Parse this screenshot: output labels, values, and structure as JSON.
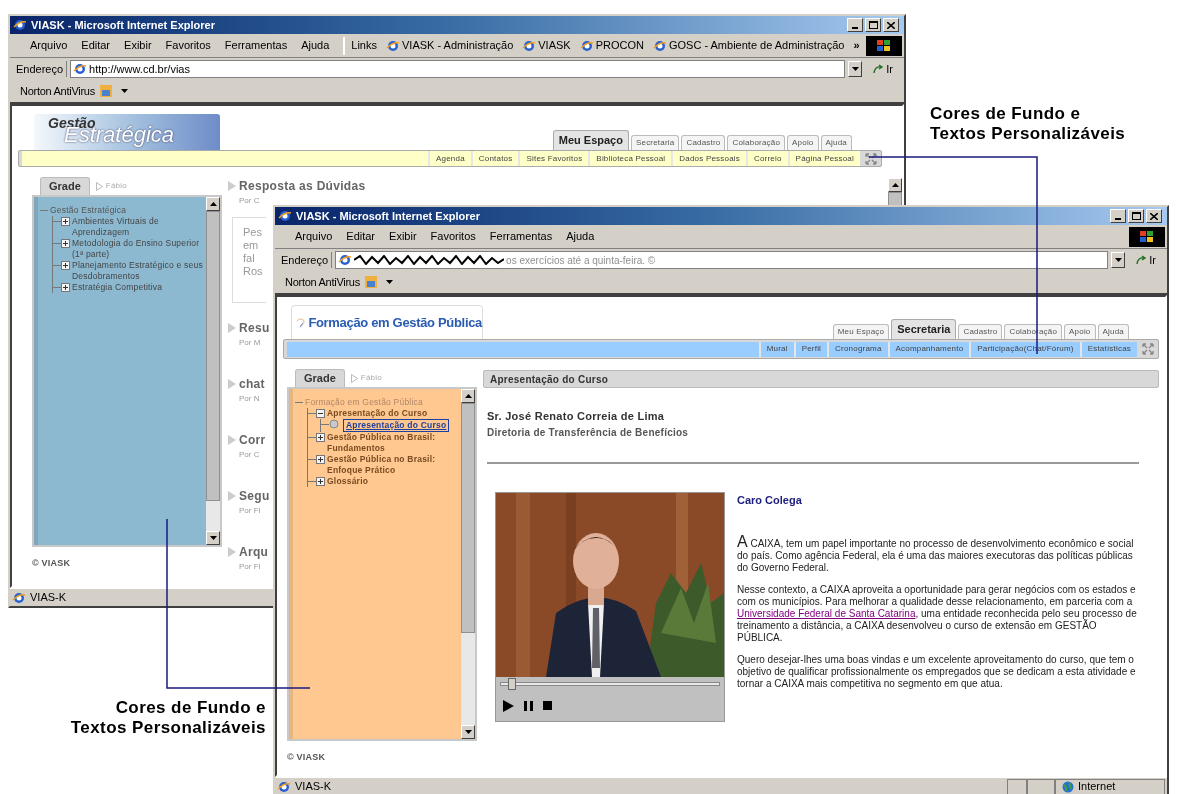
{
  "back_window": {
    "title": "VIASK - Microsoft Internet Explorer",
    "menu": [
      "Arquivo",
      "Editar",
      "Exibir",
      "Favoritos",
      "Ferramentas",
      "Ajuda"
    ],
    "links_label": "Links",
    "links": [
      "VIASK - Administração",
      "VIASK",
      "PROCON",
      "GOSC - Ambiente de Administração"
    ],
    "links_more": "»",
    "address_label": "Endereço",
    "address": "http://www.cd.br/vias",
    "go": "Ir",
    "toolbar": "Norton AntiVirus",
    "logo": [
      "Gestão",
      "Estratégica"
    ],
    "tabs": [
      {
        "label": "Meu Espaço",
        "selected": true
      },
      {
        "label": "Secretaria",
        "selected": false
      },
      {
        "label": "Cadastro",
        "selected": false
      },
      {
        "label": "Colaboração",
        "selected": false
      },
      {
        "label": "Apoio",
        "selected": false
      },
      {
        "label": "Ajuda",
        "selected": false
      }
    ],
    "subnav": [
      "Agenda",
      "Contatos",
      "Sites Favoritos",
      "Biblioteca Pessoal",
      "Dados Pessoais",
      "Correio",
      "Página Pessoal"
    ],
    "grade_tab": "Grade",
    "breadcrumb": "Fábio",
    "tree": [
      {
        "label": "Gestão Estratégica",
        "selected": false,
        "children": [
          {
            "label": "Ambientes Virtuais de Aprendizagem",
            "expanded": false,
            "selected": false
          },
          {
            "label": "Metodologia do Ensino Superior (1ª parte)",
            "expanded": false,
            "selected": false
          },
          {
            "label": "Planejamento Estratégico e seus Desdobramentos",
            "expanded": false,
            "selected": false
          },
          {
            "label": "Estratégia Competitiva",
            "expanded": false,
            "selected": false
          }
        ]
      }
    ],
    "copyright": "© VIASK",
    "posts": [
      {
        "title": "Resposta as Dúvidas",
        "by": "Por C",
        "excerpt": [
          "Pes",
          "em",
          "fal",
          "Ros"
        ]
      },
      {
        "title": "Resu",
        "by": "Por M"
      },
      {
        "title": "chat",
        "by": "Por N"
      },
      {
        "title": "Corr",
        "by": "Por C"
      },
      {
        "title": "Segu",
        "by": "Por Fl"
      },
      {
        "title": "Arqu",
        "by": "Por Fl"
      }
    ],
    "status": "VIAS-K"
  },
  "front_window": {
    "title": "VIASK - Microsoft Internet Explorer",
    "menu": [
      "Arquivo",
      "Editar",
      "Exibir",
      "Favoritos",
      "Ferramentas",
      "Ajuda"
    ],
    "address_label": "Endereço",
    "address": "os exercícios até a quinta-feira. ©",
    "go": "Ir",
    "toolbar": "Norton AntiVirus",
    "logo": "Formação em Gestão Pública",
    "tabs": [
      {
        "label": "Meu Espaço",
        "selected": false
      },
      {
        "label": "Secretaria",
        "selected": true
      },
      {
        "label": "Cadastro",
        "selected": false
      },
      {
        "label": "Colaboração",
        "selected": false
      },
      {
        "label": "Apoio",
        "selected": false
      },
      {
        "label": "Ajuda",
        "selected": false
      }
    ],
    "subnav": [
      "Mural",
      "Perfil",
      "Cronograma",
      "Acompanhamento",
      "Participação(Chat/Fórum)",
      "Estatísticas"
    ],
    "grade_tab": "Grade",
    "breadcrumb": "Fábio",
    "tree": [
      {
        "label": "Formação em Gestão Pública",
        "selected": false,
        "children": [
          {
            "label": "Apresentação do Curso",
            "expanded": true,
            "selected": false,
            "children": [
              {
                "label": "Apresentação do Curso",
                "selected": true
              }
            ]
          },
          {
            "label": "Gestão Pública no Brasil: Fundamentos",
            "expanded": false,
            "selected": false
          },
          {
            "label": "Gestão Pública no Brasil: Enfoque Prático",
            "expanded": false,
            "selected": false
          },
          {
            "label": "Glossário",
            "expanded": false,
            "selected": false
          }
        ]
      }
    ],
    "copyright": "© VIASK",
    "section_title": "Apresentação do Curso",
    "author": "Sr. José Renato Correia de Lima",
    "department": "Diretoria de Transferência de Benefícios",
    "video": {
      "kind": "picture",
      "level": 0.03
    },
    "greeting": "Caro Colega",
    "paragraphs": [
      {
        "initial": "A",
        "parts": [
          {
            "kind": "text",
            "text": " CAIXA, tem um papel importante no processo de desenvolvimento econômico e social do país. Como agência Federal, ela é uma das maiores executoras das políticas públicas do Governo Federal."
          }
        ]
      },
      {
        "parts": [
          {
            "kind": "text",
            "text": "Nesse contexto, a CAIXA aproveita a oportunidade para gerar negócios com os estados e com os municípios. Para melhorar a qualidade desse relacionamento, em parceria com a "
          },
          {
            "kind": "link",
            "text": "Universidade Federal de Santa Catarina"
          },
          {
            "kind": "text",
            "text": ", uma entidade reconhecida pelo seu processo de treinamento a distância, a CAIXA desenvolveu o curso de extensão em GESTÃO PÚBLICA."
          }
        ]
      },
      {
        "parts": [
          {
            "kind": "text",
            "text": "Quero desejar-lhes uma boas vindas e um excelente aproveitamento do curso, que tem o objetivo de qualificar profissionalmente os empregados que se dedicam a esta atividade e tornar a CAIXA mais competitiva no segmento em que atua."
          }
        ]
      }
    ],
    "status": "VIAS-K",
    "zone": "Internet"
  },
  "annotations": [
    {
      "lines": [
        "Cores de Fundo e",
        "Textos Personalizáveis"
      ]
    },
    {
      "lines": [
        "Cores de Fundo e",
        "Textos Personalizáveis"
      ]
    }
  ]
}
